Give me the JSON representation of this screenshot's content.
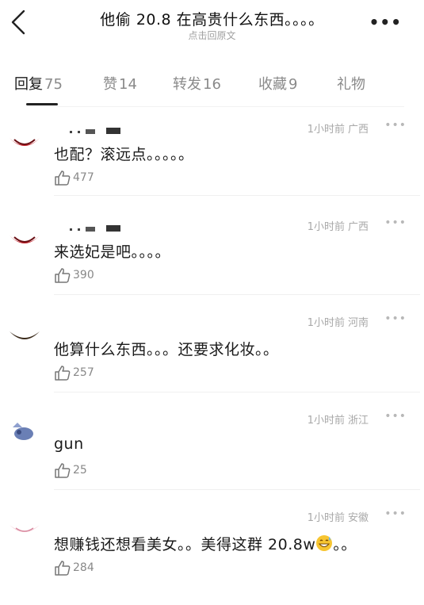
{
  "header": {
    "title": "他偷 20.8 在高贵什么东西。。。。",
    "subtitle": "点击回原文",
    "more_label": "•••"
  },
  "tabs": [
    {
      "label": "回复",
      "count": "75",
      "active": true
    },
    {
      "label": "赞",
      "count": "14",
      "active": false
    },
    {
      "label": "转发",
      "count": "16",
      "active": false
    },
    {
      "label": "收藏",
      "count": "9",
      "active": false
    },
    {
      "label": "礼物",
      "count": "",
      "active": false
    }
  ],
  "comments": [
    {
      "text": "也配？滚远点。。。。。",
      "time": "1小时前",
      "location": "广西",
      "likes": "477",
      "menu": "•••"
    },
    {
      "text": "来选妃是吧。。。。",
      "time": "1小时前",
      "location": "广西",
      "likes": "390",
      "menu": "•••"
    },
    {
      "text": "他算什么东西。。。还要求化妆。。",
      "time": "1小时前",
      "location": "河南",
      "likes": "257",
      "menu": "•••"
    },
    {
      "text": "gun",
      "time": "1小时前",
      "location": "浙江",
      "likes": "25",
      "menu": "•••"
    },
    {
      "text_before": "想赚钱还想看美女。。美得这群 20.8w",
      "text_after": "。。",
      "time": "1小时前",
      "location": "安徽",
      "likes": "284",
      "menu": "•••",
      "emoji": "grinning-sweat-emoji"
    }
  ],
  "icons": {
    "back": "chevron-left-icon",
    "more": "more-dots-icon",
    "like": "thumbs-up-icon"
  }
}
